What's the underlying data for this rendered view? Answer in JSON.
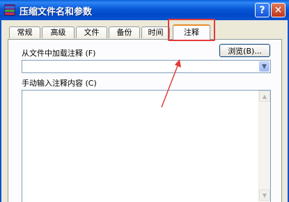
{
  "window": {
    "title": "压缩文件名和参数",
    "help_glyph": "?",
    "close_glyph": "✕"
  },
  "tabs": [
    {
      "label": "常规"
    },
    {
      "label": "高级"
    },
    {
      "label": "文件"
    },
    {
      "label": "备份"
    },
    {
      "label": "时间"
    },
    {
      "label": "注释",
      "active": true
    }
  ],
  "comment_file": {
    "label": "从文件中加载注释 (F)",
    "browse_label": "浏览(B)...",
    "value": ""
  },
  "manual_comment": {
    "label": "手动输入注释内容 (C)",
    "value": ""
  },
  "colors": {
    "annotation": "#e23a3a",
    "titlebar": "#0757d6",
    "active_tab_accent": "#e68b2c"
  }
}
